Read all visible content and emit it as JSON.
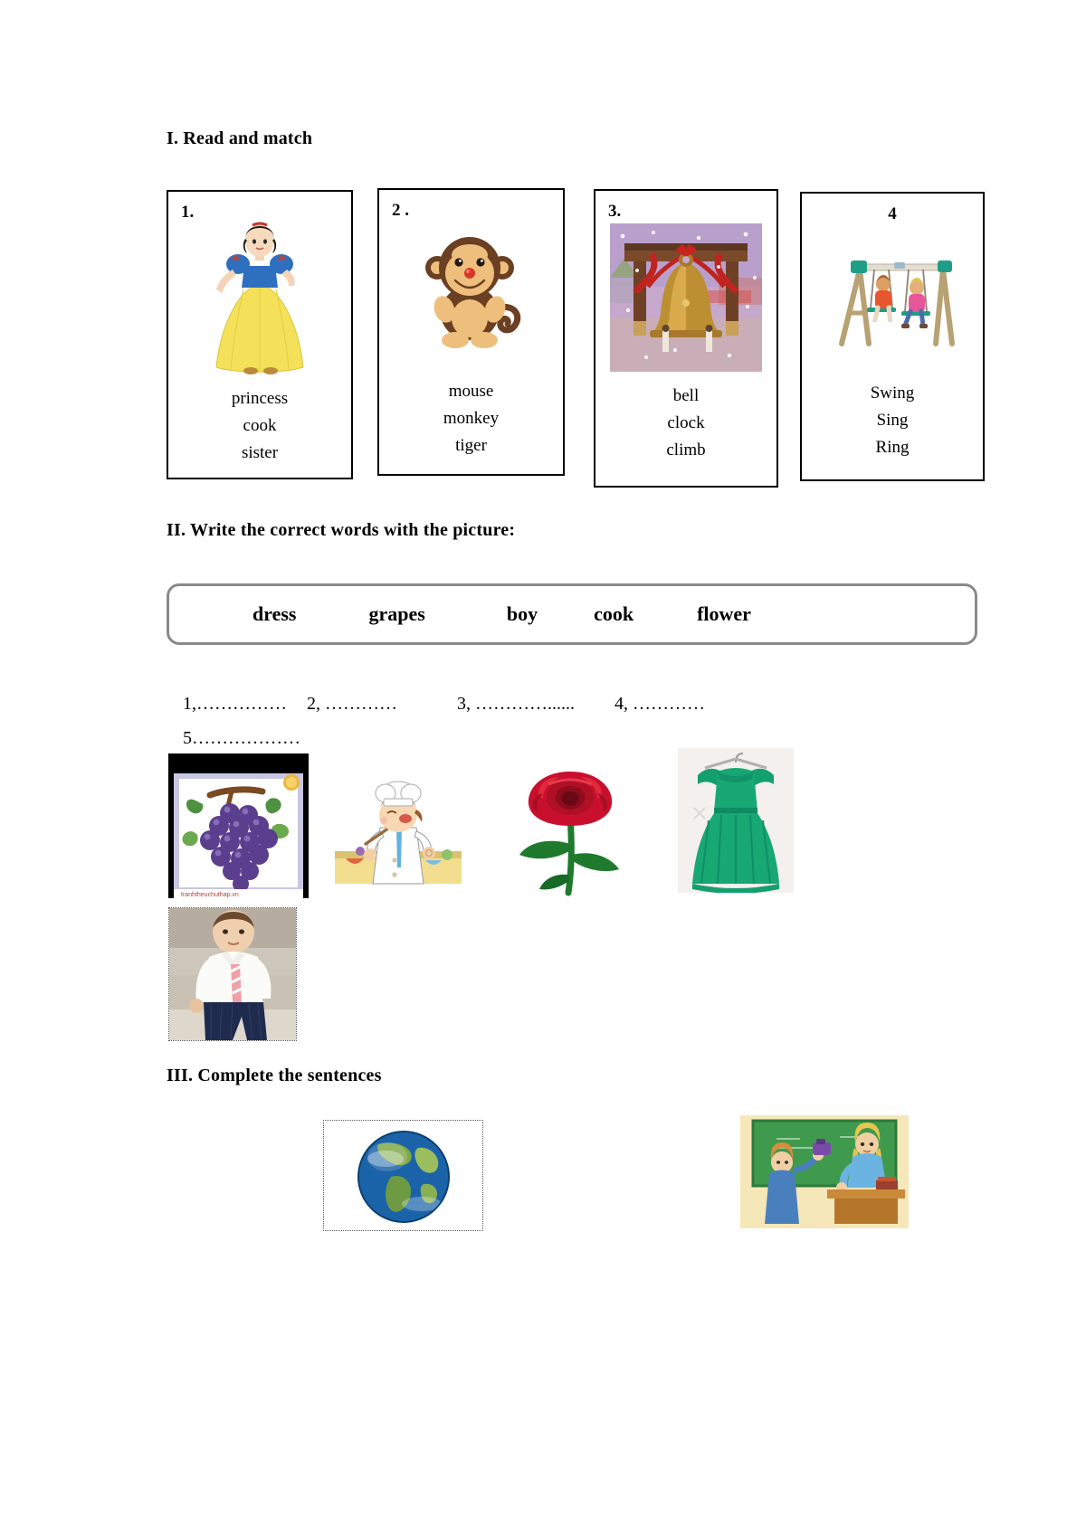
{
  "document": {
    "type": "english-worksheet",
    "sections": [
      {
        "id": "I",
        "heading": "I. Read and match"
      },
      {
        "id": "II",
        "heading": "II. Write the correct words with the picture:"
      },
      {
        "id": "III",
        "heading": "III. Complete the sentences"
      }
    ]
  },
  "section1": {
    "heading": "I. Read and match",
    "cards": [
      {
        "number": "1.",
        "image": "princess-image",
        "image_alt": "Snow White princess in blue bodice and yellow gown",
        "options": [
          "princess",
          "cook",
          "sister"
        ]
      },
      {
        "number": "2 .",
        "image": "monkey-toy-image",
        "image_alt": "Brown and tan toy monkey with red nose",
        "options": [
          "mouse",
          "monkey",
          "tiger"
        ]
      },
      {
        "number": "3.",
        "image": "bell-image",
        "image_alt": "Large golden bell hanging on wooden frame with red ribbons in snow",
        "options": [
          "bell",
          "clock",
          "climb"
        ]
      },
      {
        "number": "4",
        "image": "swing-image",
        "image_alt": "Wooden swing set with two children swinging",
        "options": [
          "Swing",
          "Sing",
          "Ring"
        ]
      }
    ]
  },
  "section2": {
    "heading": "II. Write the correct words with the picture:",
    "word_bank": [
      "dress",
      "grapes",
      "boy",
      "cook",
      "flower"
    ],
    "answer_lines": [
      {
        "label": "1,",
        "dots": "……………"
      },
      {
        "label": "2,",
        "dots": " …………"
      },
      {
        "label": "3,",
        "dots": " …………......"
      },
      {
        "label": "4,",
        "dots": " …………"
      },
      {
        "label": "5",
        "dots": "………………"
      }
    ],
    "pictures": [
      {
        "name": "grapes-picture",
        "alt": "Bunch of purple grapes with green leaves in a framed picture"
      },
      {
        "name": "cook-picture",
        "alt": "Cartoon chef in white hat tasting with a spoon at a kitchen counter"
      },
      {
        "name": "flower-picture",
        "alt": "Red rose with green stem and leaves"
      },
      {
        "name": "dress-picture",
        "alt": "Green pleated dress on a hanger"
      },
      {
        "name": "boy-picture",
        "alt": "Young boy in white shirt and striped tie sitting on steps"
      }
    ]
  },
  "section3": {
    "heading": "III. Complete the sentences",
    "pictures": [
      {
        "name": "globe-picture",
        "alt": "Planet Earth globe showing blue oceans and green continents"
      },
      {
        "name": "classroom-picture",
        "alt": "Classroom scene with teacher at desk and student at green chalkboard"
      }
    ]
  },
  "colors": {
    "text": "#000000",
    "card_border": "#000000",
    "wordbank_border": "#8a8a8a",
    "page_background": "#ffffff"
  }
}
